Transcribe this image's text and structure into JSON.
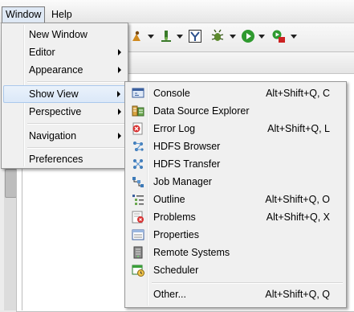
{
  "menubar": {
    "window": "Window",
    "help": "Help"
  },
  "window_menu": {
    "items": {
      "new_window": "New Window",
      "editor": "Editor",
      "appearance": "Appearance",
      "show_view": "Show View",
      "perspective": "Perspective",
      "navigation": "Navigation",
      "preferences": "Preferences"
    }
  },
  "show_view_menu": {
    "items": [
      {
        "label": "Console",
        "accel": "Alt+Shift+Q, C",
        "icon": "console-icon"
      },
      {
        "label": "Data Source Explorer",
        "accel": "",
        "icon": "data-source-explorer-icon"
      },
      {
        "label": "Error Log",
        "accel": "Alt+Shift+Q, L",
        "icon": "error-log-icon"
      },
      {
        "label": "HDFS Browser",
        "accel": "",
        "icon": "hdfs-browser-icon"
      },
      {
        "label": "HDFS Transfer",
        "accel": "",
        "icon": "hdfs-transfer-icon"
      },
      {
        "label": "Job Manager",
        "accel": "",
        "icon": "job-manager-icon"
      },
      {
        "label": "Outline",
        "accel": "Alt+Shift+Q, O",
        "icon": "outline-icon"
      },
      {
        "label": "Problems",
        "accel": "Alt+Shift+Q, X",
        "icon": "problems-icon"
      },
      {
        "label": "Properties",
        "accel": "",
        "icon": "properties-icon"
      },
      {
        "label": "Remote Systems",
        "accel": "",
        "icon": "remote-systems-icon"
      },
      {
        "label": "Scheduler",
        "accel": "",
        "icon": "scheduler-icon"
      },
      {
        "label": "Other...",
        "accel": "Alt+Shift+Q, Q",
        "icon": ""
      }
    ]
  },
  "colors": {
    "highlight": "#dbe8f8",
    "menu_bg": "#f0f0f0"
  }
}
